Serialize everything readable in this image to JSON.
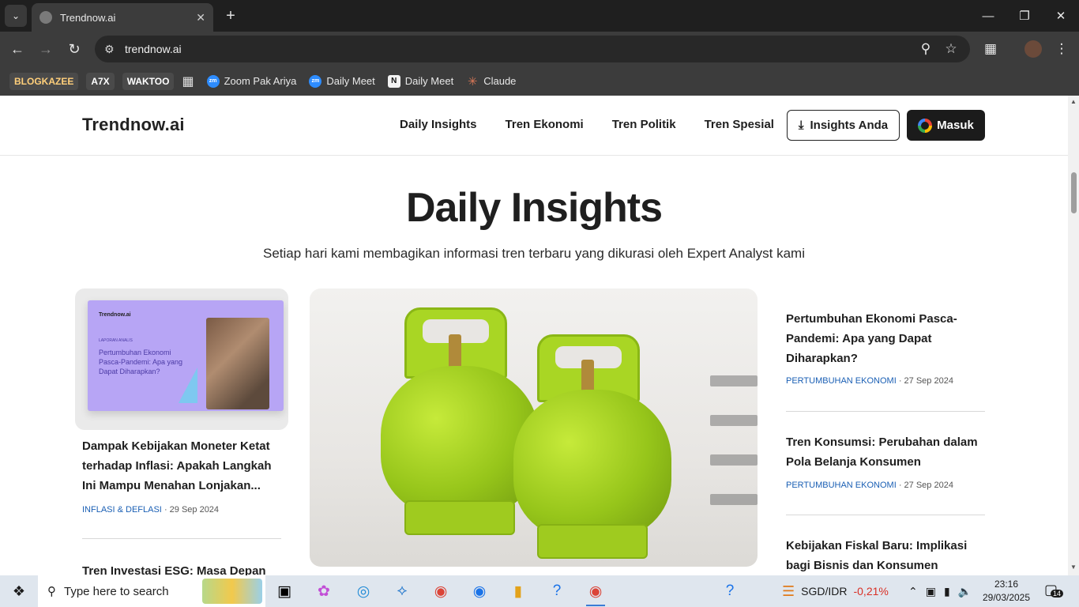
{
  "browser": {
    "tab_title": "Trendnow.ai",
    "url": "trendnow.ai",
    "bookmarks": {
      "badge1": "BLOGKAZEE",
      "badge2": "A7X",
      "badge3": "WAKTOO",
      "item1": "Zoom Pak Ariya",
      "item2": "Daily Meet",
      "item3": "Daily Meet",
      "item4": "Claude",
      "zoom_icon_text": "zm",
      "notion_icon_text": "N"
    }
  },
  "site": {
    "logo": "Trendnow.ai",
    "nav": [
      "Daily Insights",
      "Tren Ekonomi",
      "Tren Politik",
      "Tren Spesial"
    ],
    "insights_button": "Insights Anda",
    "login_button": "Masuk"
  },
  "hero": {
    "title": "Daily Insights",
    "subtitle": "Setiap hari kami membagikan informasi tren terbaru yang dikurasi oleh Expert Analyst kami"
  },
  "thumbnail": {
    "logo": "Trendnow.ai",
    "kicker": "LAPORAN ANALIS",
    "title": "Pertumbuhan Ekonomi Pasca-Pandemi: Apa yang Dapat Diharapkan?"
  },
  "left_articles": [
    {
      "title": "Dampak Kebijakan Moneter Ketat terhadap Inflasi: Apakah Langkah Ini Mampu Menahan Lonjakan...",
      "category": "INFLASI & DEFLASI",
      "date": "· 29 Sep 2024"
    },
    {
      "title": "Tren Investasi ESG: Masa Depan"
    }
  ],
  "right_articles": [
    {
      "title": "Pertumbuhan Ekonomi Pasca-Pandemi: Apa yang Dapat Diharapkan?",
      "category": "PERTUMBUHAN EKONOMI",
      "date": "· 27 Sep 2024"
    },
    {
      "title": "Tren Konsumsi: Perubahan dalam Pola Belanja Konsumen",
      "category": "PERTUMBUHAN EKONOMI",
      "date": "· 27 Sep 2024"
    },
    {
      "title": "Kebijakan Fiskal Baru: Implikasi bagi Bisnis dan Konsumen"
    }
  ],
  "taskbar": {
    "search_placeholder": "Type here to search",
    "currency_pair": "SGD/IDR",
    "currency_change": "-0,21%",
    "time": "23:16",
    "date": "29/03/2025",
    "notification_count": "14"
  },
  "colors": {
    "accent_link": "#1a5fb4",
    "negative": "#d93025",
    "thumbnail_purple": "#b7a5f5"
  }
}
